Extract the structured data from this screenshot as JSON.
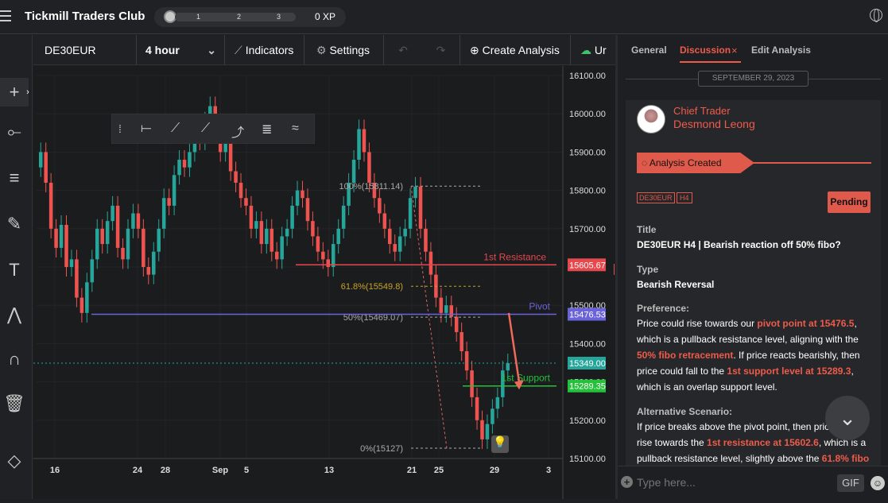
{
  "app": {
    "title": "Tickmill Traders Club",
    "xp": "0 XP",
    "levels": [
      "1",
      "2",
      "3"
    ]
  },
  "toolbar": {
    "symbol": "DE30EUR",
    "interval": "4 hour",
    "indicators": "Indicators",
    "settings": "Settings",
    "create": "Create Analysis",
    "more": "Ur"
  },
  "panel": {
    "tabs": [
      "General",
      "Discussion",
      "Edit Analysis"
    ],
    "close_glyph": "×",
    "date": "SEPTEMBER 29, 2023",
    "author_role": "Chief Trader",
    "author_name": "Desmond Leong",
    "banner": "Analysis Created",
    "tags": [
      "DE30EUR",
      "H4"
    ],
    "status": "Pending",
    "title_label": "Title",
    "title": "DE30EUR H4 | Bearish reaction off 50% fibo?",
    "type_label": "Type",
    "type": "Bearish Reversal",
    "pref_label": "Preference:",
    "pref": [
      "Price could rise towards our ",
      "pivot point at 15476.5",
      ", which is a pullback resistance level, aligning with the ",
      "50% fibo retracement",
      ". If price reacts bearishly, then price could fall to the ",
      "1st support level at 15289.3",
      ", which is an overlap support level."
    ],
    "alt_label": "Alternative Scenario:",
    "alt": [
      "If price breaks above the pivot point, then price could rise towards the ",
      "1st resistance at 15602.6",
      ", which is a pullback resistance level, slightly above the ",
      "61.8% fibo"
    ],
    "composer_placeholder": "Type here...",
    "gif": "GIF"
  },
  "chart_data": {
    "type": "candlestick",
    "symbol": "DE30EUR",
    "interval": "4 hour",
    "y_ticks": [
      "16100.00",
      "16000.00",
      "15900.00",
      "15800.00",
      "15700.00",
      "15600.00",
      "15500.00",
      "15400.00",
      "15300.00",
      "15200.00",
      "15100.00"
    ],
    "ylim": [
      15100,
      16100
    ],
    "x_ticks": [
      "16",
      "24",
      "28",
      "Sep",
      "5",
      "13",
      "21",
      "25",
      "29",
      "3"
    ],
    "levels": [
      {
        "name": "1st Resistance",
        "value": 15605.67,
        "label": "15605.67",
        "color": "#e5484d"
      },
      {
        "name": "Pivot",
        "value": 15476.53,
        "label": "15476.53",
        "color": "#6b63d9"
      },
      {
        "name": "1st Support",
        "value": 15289.35,
        "label": "15289.35",
        "color": "#26c13b"
      },
      {
        "name": "",
        "value": 15349.0,
        "label": "15349.00",
        "color": "#26a69a"
      }
    ],
    "fib": [
      {
        "label": "100%(15811.14)",
        "value": 15811.14
      },
      {
        "label": "61.8%(15549.8)",
        "value": 15549.8
      },
      {
        "label": "50%(15469.07)",
        "value": 15469.07
      },
      {
        "label": "0%(15127)",
        "value": 15127
      }
    ],
    "closes": [
      15900,
      15820,
      15700,
      15650,
      15710,
      15600,
      15620,
      15520,
      15480,
      15560,
      15620,
      15700,
      15660,
      15720,
      15760,
      15650,
      15620,
      15700,
      15740,
      15700,
      15600,
      15580,
      15640,
      15700,
      15780,
      15760,
      15840,
      15880,
      15860,
      15900,
      15960,
      15930,
      15980,
      16020,
      15950,
      15900,
      15930,
      15850,
      15820,
      15780,
      15760,
      15700,
      15720,
      15660,
      15700,
      15640,
      15620,
      15680,
      15700,
      15760,
      15800,
      15780,
      15720,
      15680,
      15640,
      15620,
      15600,
      15660,
      15700,
      15760,
      15820,
      15880,
      15960,
      15900,
      15820,
      15780,
      15740,
      15700,
      15660,
      15640,
      15680,
      15700,
      15780,
      15810,
      15700,
      15640,
      15580,
      15520,
      15480,
      15500,
      15470,
      15430,
      15380,
      15330,
      15260,
      15200,
      15150,
      15190,
      15230,
      15260,
      15330,
      15349
    ]
  }
}
